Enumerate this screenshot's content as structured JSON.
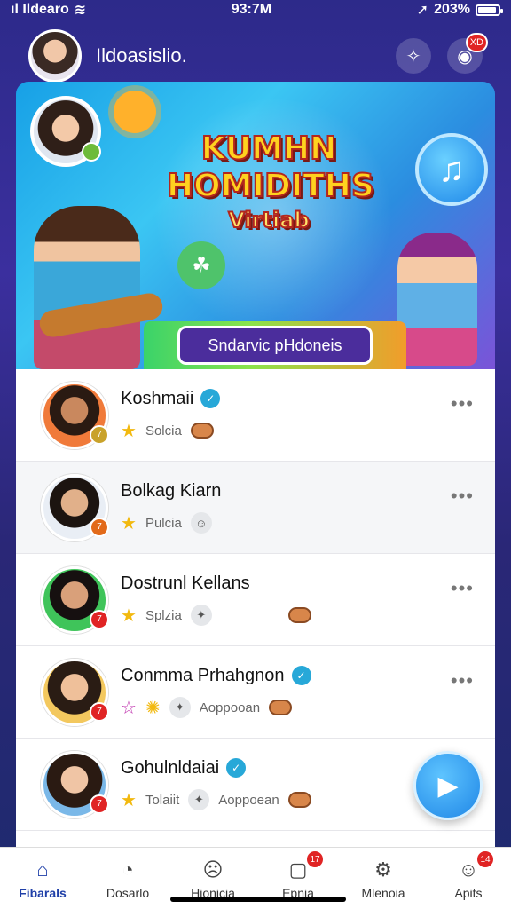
{
  "status": {
    "carrier": "ıl Ildearo",
    "time": "93:7M",
    "battery": "203%"
  },
  "header": {
    "title": "Ildoasislio.",
    "badge": "XD"
  },
  "banner": {
    "title_line1": "KUMHN",
    "title_line2": "HOMIDITHS",
    "title_line3": "Virtiab",
    "button_label": "Sndarvic pHdoneis"
  },
  "contacts": [
    {
      "name": "Koshmaii",
      "tag": "Solcia",
      "verified": true
    },
    {
      "name": "Bolkag Kiarn",
      "tag": "Pulcia",
      "verified": false
    },
    {
      "name": "Dostrunl Kellans",
      "tag": "Splzia",
      "verified": false
    },
    {
      "name": "Conmma Prhahgnon",
      "tag": "Aoppooan",
      "verified": true
    },
    {
      "name": "Gohulnldaiai",
      "tag": "Aoppoean",
      "verified": true
    }
  ],
  "contact_extra": {
    "tag_a": "Tolaiit",
    "tag_b": "Aoppoean"
  },
  "nav": {
    "items": [
      {
        "label": "Fibarals"
      },
      {
        "label": "Dosarlo"
      },
      {
        "label": "Hionicia"
      },
      {
        "label": "Epnia"
      },
      {
        "label": "Mlenoia"
      },
      {
        "label": "Apits"
      }
    ],
    "badge_4": "17",
    "badge_6": "14"
  },
  "colors": {
    "accent": "#1f86e6",
    "badge": "#e02424",
    "verified": "#27a8d8"
  }
}
